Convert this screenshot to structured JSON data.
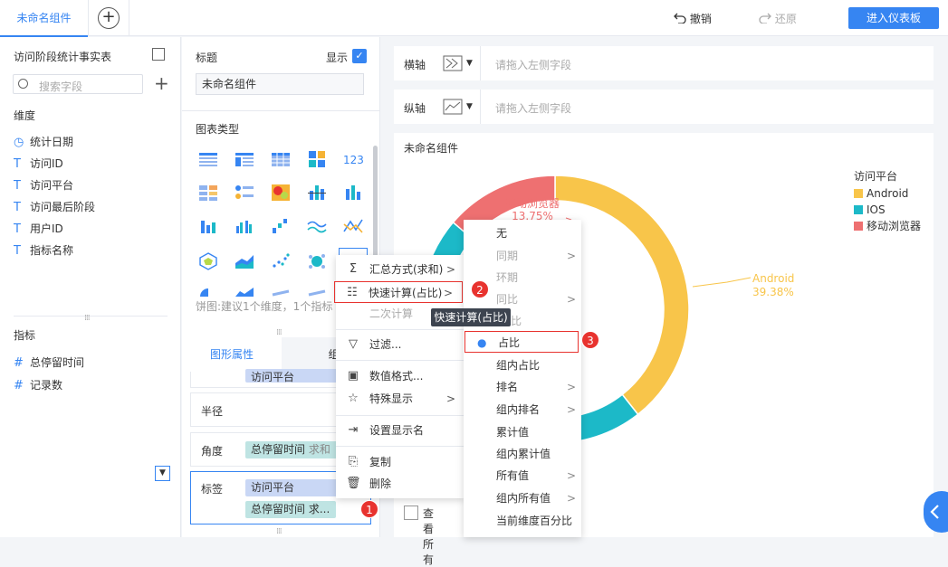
{
  "topbar": {
    "tab": "未命名组件",
    "undo": "撤销",
    "redo": "还原",
    "enter": "进入仪表板"
  },
  "left": {
    "dataset": "访问阶段统计事实表",
    "search_placeholder": "搜索字段",
    "dim_title": "维度",
    "dimensions": [
      {
        "icon": "clock-icon",
        "label": "统计日期"
      },
      {
        "icon": "text-type-icon",
        "label": "访问ID"
      },
      {
        "icon": "text-type-icon",
        "label": "访问平台"
      },
      {
        "icon": "text-type-icon",
        "label": "访问最后阶段"
      },
      {
        "icon": "text-type-icon",
        "label": "用户ID"
      },
      {
        "icon": "text-type-icon",
        "label": "指标名称"
      }
    ],
    "metric_title": "指标",
    "metrics": [
      {
        "icon": "number-type-icon",
        "label": "总停留时间"
      },
      {
        "icon": "number-type-icon",
        "label": "记录数"
      }
    ]
  },
  "mid": {
    "title_label": "标题",
    "show_label": "显示",
    "title_value": "未命名组件",
    "chart_type_label": "图表类型",
    "pie_hint": "饼图:建议1个维度，1个指标",
    "tab_attr": "图形属性",
    "tab_comp": "组件样",
    "partial_chip": "访问平台",
    "radius": "半径",
    "angle": "角度",
    "angle_chip": "总停留时间",
    "angle_chip_suffix": "求和",
    "label_row": "标签",
    "label_chip1": "访问平台",
    "label_chip2": "总停留时间 求..."
  },
  "axes": {
    "x_label": "横轴",
    "y_label": "纵轴",
    "placeholder": "请拖入左侧字段"
  },
  "canvas": {
    "title": "未命名组件",
    "legend_title": "访问平台",
    "view_all": "查看所有"
  },
  "chart_data": {
    "type": "pie",
    "categories": [
      "Android",
      "IOS",
      "移动浏览器"
    ],
    "values": [
      39.38,
      null,
      13.75
    ],
    "colors": [
      "#f8c54a",
      "#1cb9c8",
      "#ee7071"
    ],
    "labels": {
      "Android": "39.38%",
      "移动浏览器": "13.75%"
    }
  },
  "context_menu": {
    "items": [
      {
        "icon": "sigma-icon",
        "label": "汇总方式(求和)",
        "arrow": true
      },
      {
        "icon": "quick-calc-icon",
        "label": "快速计算(占比)",
        "arrow": true
      },
      {
        "label": "二次计算",
        "disabled": true
      },
      {
        "icon": "filter-icon",
        "label": "过滤..."
      },
      {
        "icon": "number-format-icon",
        "label": "数值格式..."
      },
      {
        "icon": "star-icon",
        "label": "特殊显示",
        "arrow": true
      },
      {
        "icon": "rename-icon",
        "label": "设置显示名"
      },
      {
        "icon": "copy-icon",
        "label": "复制"
      },
      {
        "icon": "trash-icon",
        "label": "删除"
      }
    ]
  },
  "tooltip": "快速计算(占比)",
  "submenu": {
    "items": [
      {
        "label": "无"
      },
      {
        "label": "同期",
        "disabled": true,
        "arrow": true
      },
      {
        "label": "环期",
        "disabled": true
      },
      {
        "label": "同比",
        "disabled": true,
        "arrow": true
      },
      {
        "label": "环比",
        "disabled": true
      },
      {
        "label": "占比",
        "selected": true
      },
      {
        "label": "组内占比"
      },
      {
        "label": "排名",
        "arrow": true
      },
      {
        "label": "组内排名",
        "arrow": true
      },
      {
        "label": "累计值"
      },
      {
        "label": "组内累计值"
      },
      {
        "label": "所有值",
        "arrow": true
      },
      {
        "label": "组内所有值",
        "arrow": true
      },
      {
        "label": "当前维度百分比"
      }
    ]
  },
  "badges": [
    "1",
    "2",
    "3"
  ],
  "colors": {
    "accent": "#3685f2",
    "badge": "#e8332f"
  }
}
